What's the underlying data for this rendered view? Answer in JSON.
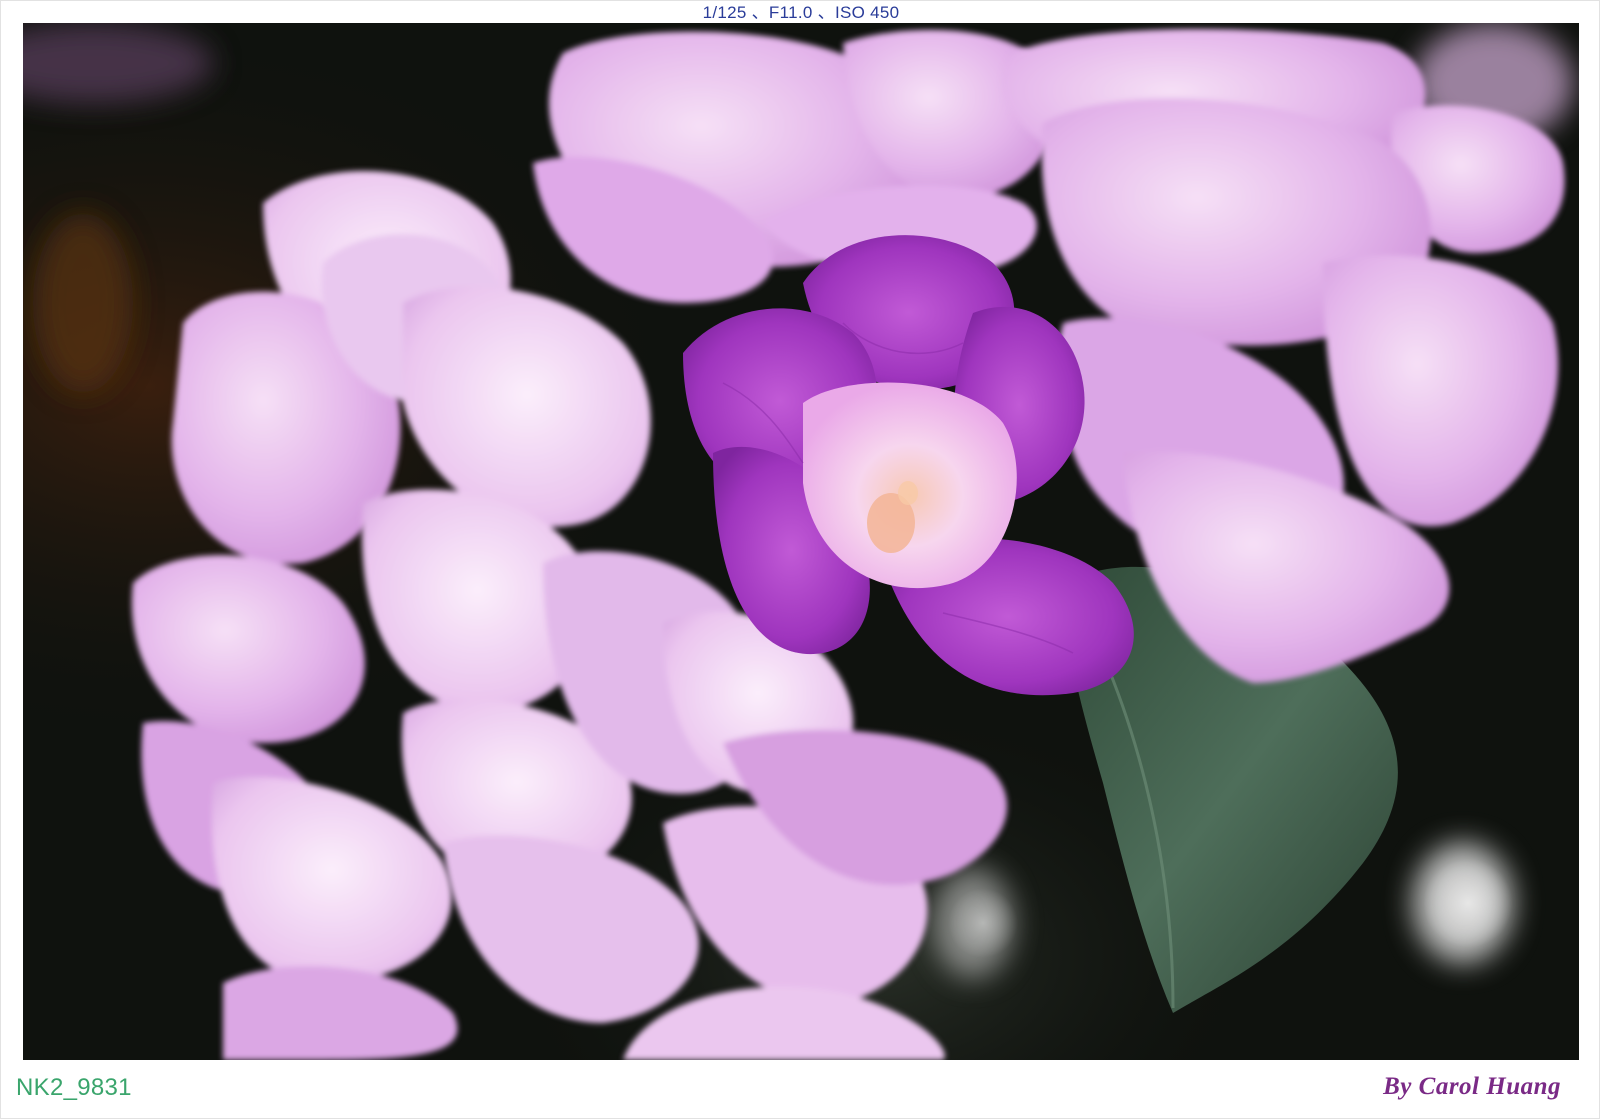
{
  "exif_line": "1/125 、F11.0 、ISO 450",
  "file_id": "NK2_9831",
  "credit": "By Carol Huang",
  "colors": {
    "exif_text": "#2a3c99",
    "file_id_text": "#3aa56c",
    "credit_text": "#7a2a86",
    "petal_light": "#e4b9ec",
    "petal_pale": "#f1d9f4",
    "petal_deep": "#a23bc2",
    "leaf": "#3f5a48",
    "background": "#0f120e"
  }
}
